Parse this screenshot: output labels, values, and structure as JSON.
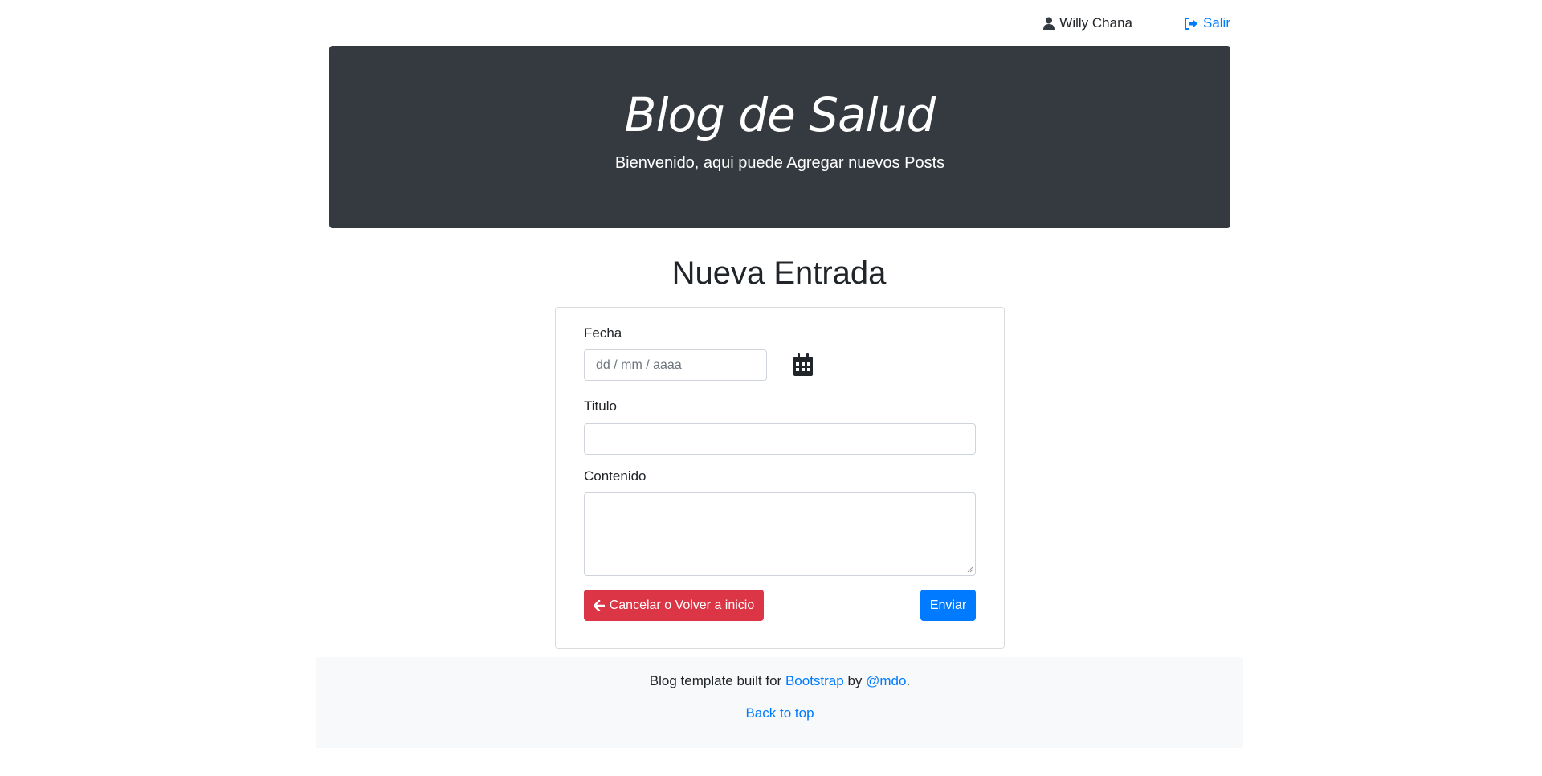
{
  "header": {
    "user_name": "Willy Chana",
    "user_icon": "user-icon",
    "logout_label": "Salir",
    "logout_icon": "sign-out-icon"
  },
  "jumbotron": {
    "title": "Blog de Salud",
    "subtitle": "Bienvenido, aqui puede Agregar nuevos Posts"
  },
  "main": {
    "title": "Nueva Entrada"
  },
  "form": {
    "date_label": "Fecha",
    "date_placeholder": "dd / mm / aaaa",
    "calendar_icon": "calendar-icon",
    "title_label": "Titulo",
    "title_value": "",
    "content_label": "Contenido",
    "content_value": "",
    "cancel_label": "Cancelar o Volver a inicio",
    "cancel_icon": "arrow-left-icon",
    "submit_label": "Enviar"
  },
  "footer": {
    "text_before": "Blog template built for ",
    "link1": "Bootstrap",
    "text_mid": " by ",
    "link2": "@mdo",
    "text_after": ".",
    "back_to_top": "Back to top"
  },
  "colors": {
    "primary": "#007bff",
    "danger": "#dc3545",
    "dark": "#343a40",
    "light": "#f8f9fa"
  }
}
